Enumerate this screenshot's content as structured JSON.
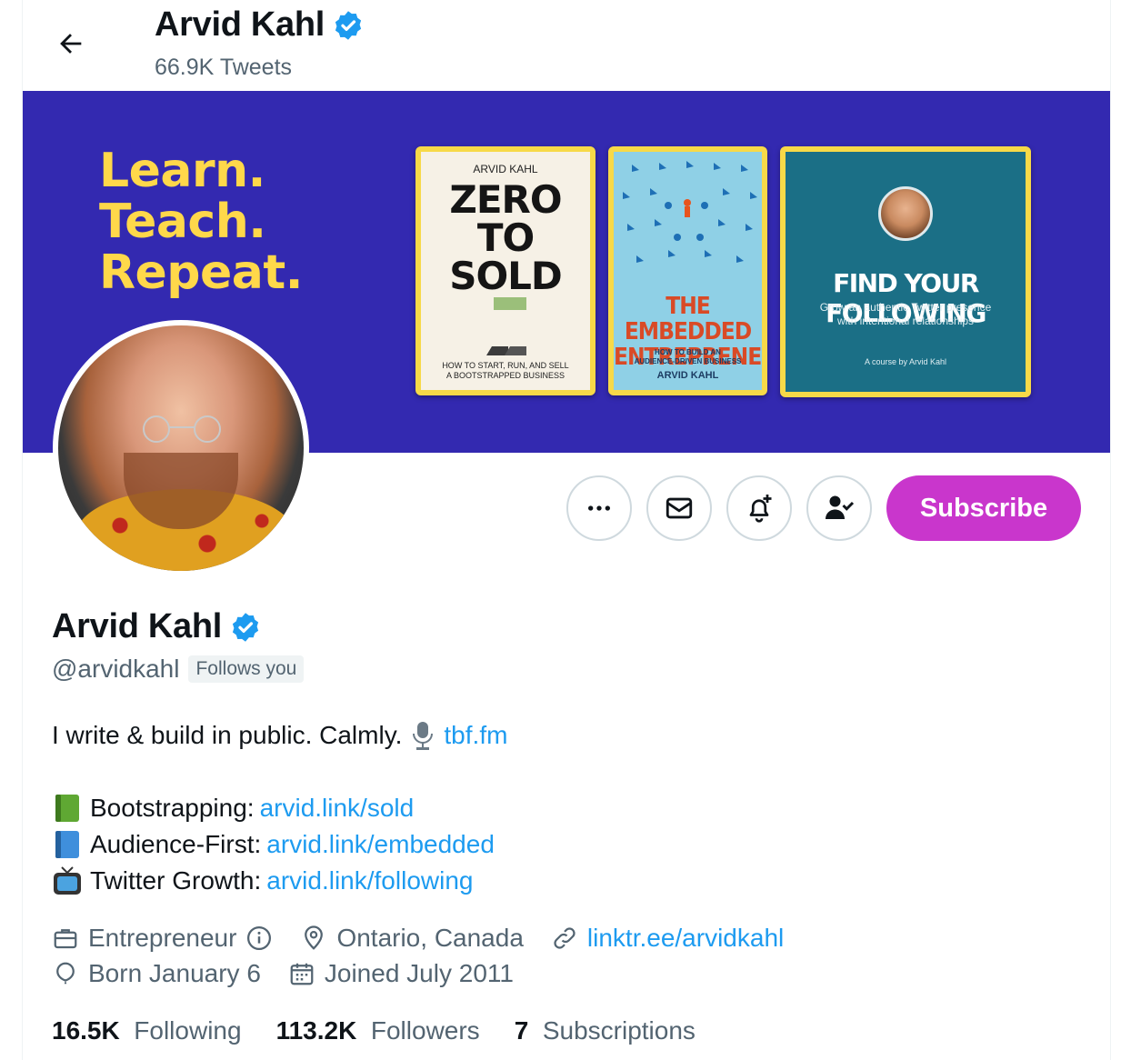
{
  "header": {
    "name": "Arvid Kahl",
    "tweet_count": "66.9K Tweets"
  },
  "banner": {
    "tagline": [
      "Learn.",
      "Teach.",
      "Repeat."
    ],
    "book1": {
      "author": "ARVID KAHL",
      "title_lines": [
        "ZERO",
        "TO",
        "SOLD"
      ],
      "subtitle_lines": [
        "HOW TO START, RUN, AND SELL",
        "A BOOTSTRAPPED BUSINESS"
      ]
    },
    "book2": {
      "title_lines": [
        "THE EMBEDDED",
        "ENTREPRENEUR"
      ],
      "subtitle_lines": [
        "HOW TO BUILD AN",
        "AUDIENCE-DRIVEN BUSINESS"
      ],
      "author": "ARVID KAHL"
    },
    "book3": {
      "title": "FIND YOUR FOLLOWING",
      "subtitle_lines": [
        "Grow an authentic Twitter presence",
        "with intentional relationships"
      ],
      "byline": "A course by Arvid Kahl"
    },
    "colors": {
      "background": "#3329b0",
      "tagline": "#ffd84a",
      "book_border": "#f7d948"
    }
  },
  "actions": {
    "more": "more-icon",
    "message": "mail-icon",
    "notify": "bell-plus-icon",
    "following": "person-check-icon",
    "subscribe_label": "Subscribe",
    "subscribe_color": "#c936cc"
  },
  "profile": {
    "name": "Arvid Kahl",
    "handle": "@arvidkahl",
    "follows_you": "Follows you",
    "verified_color": "#1d9bf0"
  },
  "bio": {
    "line1_text": "I write & build in public. Calmly.",
    "line1_link": "tbf.fm",
    "items": [
      {
        "icon": "green-book-icon",
        "label": "Bootstrapping:",
        "link": "arvid.link/sold"
      },
      {
        "icon": "blue-book-icon",
        "label": "Audience-First:",
        "link": "arvid.link/embedded"
      },
      {
        "icon": "tv-icon",
        "label": "Twitter Growth:",
        "link": "arvid.link/following"
      }
    ]
  },
  "meta": {
    "category": "Entrepreneur",
    "location": "Ontario, Canada",
    "website": "linktr.ee/arvidkahl",
    "birthday": "Born January 6",
    "joined": "Joined July 2011"
  },
  "stats": {
    "following_count": "16.5K",
    "following_label": "Following",
    "followers_count": "113.2K",
    "followers_label": "Followers",
    "subscriptions_count": "7",
    "subscriptions_label": "Subscriptions"
  }
}
